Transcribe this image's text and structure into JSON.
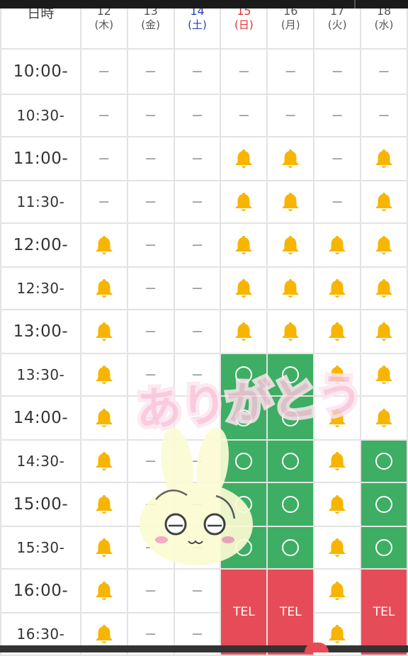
{
  "header": {
    "corner_label": "日時",
    "days": [
      {
        "date": "12",
        "dow": "(木)",
        "kind": "weekday"
      },
      {
        "date": "13",
        "dow": "(金)",
        "kind": "weekday"
      },
      {
        "date": "14",
        "dow": "(土)",
        "kind": "sat"
      },
      {
        "date": "15",
        "dow": "(日)",
        "kind": "sun"
      },
      {
        "date": "16",
        "dow": "(月)",
        "kind": "weekday"
      },
      {
        "date": "17",
        "dow": "(火)",
        "kind": "weekday"
      },
      {
        "date": "18",
        "dow": "(水)",
        "kind": "weekday"
      }
    ]
  },
  "legend": {
    "dash": "－",
    "tel": "TEL"
  },
  "colors": {
    "available": "#3dae64",
    "tel": "#e64c57",
    "bell": "#f7b500",
    "saturday": "#2a40b8",
    "sunday": "#e23030"
  },
  "icons": {
    "bell": "bell-icon",
    "available": "circle-icon"
  },
  "rows": [
    {
      "time": "10:00-",
      "cells": [
        "-",
        "-",
        "-",
        "-",
        "-",
        "-",
        "-"
      ]
    },
    {
      "time": "10:30-",
      "cells": [
        "-",
        "-",
        "-",
        "-",
        "-",
        "-",
        "-"
      ]
    },
    {
      "time": "11:00-",
      "cells": [
        "-",
        "-",
        "-",
        "bell",
        "bell",
        "-",
        "bell"
      ]
    },
    {
      "time": "11:30-",
      "cells": [
        "-",
        "-",
        "-",
        "bell",
        "bell",
        "-",
        "bell"
      ]
    },
    {
      "time": "12:00-",
      "cells": [
        "bell",
        "-",
        "-",
        "bell",
        "bell",
        "bell",
        "bell"
      ]
    },
    {
      "time": "12:30-",
      "cells": [
        "bell",
        "-",
        "-",
        "bell",
        "bell",
        "bell",
        "bell"
      ]
    },
    {
      "time": "13:00-",
      "cells": [
        "bell",
        "-",
        "-",
        "bell",
        "bell",
        "bell",
        "bell"
      ]
    },
    {
      "time": "13:30-",
      "cells": [
        "bell",
        "-",
        "-",
        "circle",
        "circle",
        "bell",
        "bell"
      ]
    },
    {
      "time": "14:00-",
      "cells": [
        "bell",
        "-",
        "-",
        "circle",
        "circle",
        "bell",
        "bell"
      ]
    },
    {
      "time": "14:30-",
      "cells": [
        "bell",
        "-",
        "-",
        "circle",
        "circle",
        "bell",
        "circle"
      ]
    },
    {
      "time": "15:00-",
      "cells": [
        "bell",
        "-",
        "-",
        "circle",
        "circle",
        "bell",
        "circle"
      ]
    },
    {
      "time": "15:30-",
      "cells": [
        "bell",
        "-",
        "-",
        "circle",
        "circle",
        "bell",
        "circle"
      ]
    },
    {
      "time": "16:00-",
      "cells": [
        "bell",
        "-",
        "-",
        "tel",
        "tel",
        "bell",
        "tel"
      ]
    },
    {
      "time": "16:30-",
      "cells": [
        "bell",
        "-",
        "-",
        "tel",
        "tel",
        "bell",
        "tel"
      ]
    }
  ],
  "sticker": {
    "text": "ありがとう"
  }
}
